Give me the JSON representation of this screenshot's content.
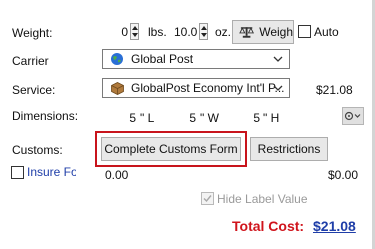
{
  "labels": {
    "weight": "Weight:",
    "carrier": "Carrier",
    "service": "Service:",
    "dimensions": "Dimensions:",
    "customs": "Customs:"
  },
  "weight": {
    "lbs_value": "0",
    "lbs_unit": "lbs.",
    "oz_value": "10.0",
    "oz_unit": "oz.",
    "weigh_button": "Weigh",
    "auto_label": "Auto"
  },
  "carrier": {
    "selected": "Global Post",
    "icon": "globe-icon"
  },
  "service": {
    "selected": "GlobalPost Economy Int'l P...",
    "icon": "package-icon",
    "price": "$21.08"
  },
  "dimensions": {
    "length_value": "5",
    "length_unit": "\" L",
    "width_value": "5",
    "width_unit": "\" W",
    "height_value": "5",
    "height_unit": "\" H"
  },
  "customs": {
    "complete_button": "Complete Customs Form",
    "restrictions_button": "Restrictions"
  },
  "insurance": {
    "label": "Insure For",
    "value": "0.00",
    "cost": "$0.00"
  },
  "hide_label_value": {
    "label": "Hide Label Value",
    "checked": true
  },
  "total": {
    "label": "Total Cost:",
    "value": "$21.08"
  },
  "colors": {
    "total_red": "#d0141c",
    "link_blue": "#1f3ea8",
    "highlight_red": "#c8141c"
  }
}
